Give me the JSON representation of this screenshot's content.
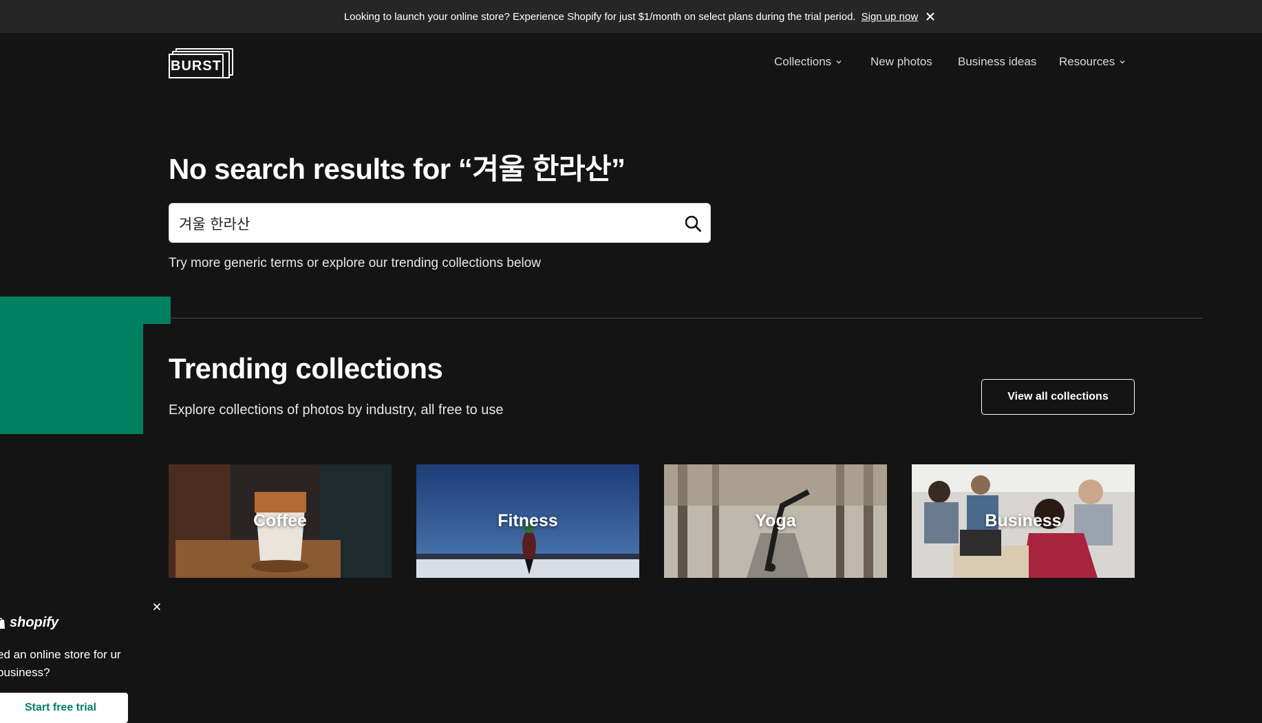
{
  "announcement": {
    "message": "Looking to launch your online store? Experience Shopify for just $1/month on select plans during the trial period.",
    "link": "Sign up now"
  },
  "logo": {
    "text": "BURST"
  },
  "nav": {
    "collections": "Collections",
    "new_photos": "New photos",
    "business_ideas": "Business ideas",
    "resources": "Resources"
  },
  "search": {
    "headline": "No search results for “겨울 한라산”",
    "value": "겨울 한라산",
    "hint": "Try more generic terms or explore our trending collections below"
  },
  "trending": {
    "title": "Trending collections",
    "subtitle": "Explore collections of photos by industry, all free to use",
    "view_all": "View all collections",
    "cards": [
      {
        "label": "Coffee"
      },
      {
        "label": "Fitness"
      },
      {
        "label": "Yoga"
      },
      {
        "label": "Business"
      }
    ]
  },
  "promo": {
    "brand": "shopify",
    "text": "ed an online store for ur business?",
    "button": "Start free trial"
  },
  "colors": {
    "background": "#141414",
    "banner": "#262626",
    "shopify_green": "#008060"
  }
}
